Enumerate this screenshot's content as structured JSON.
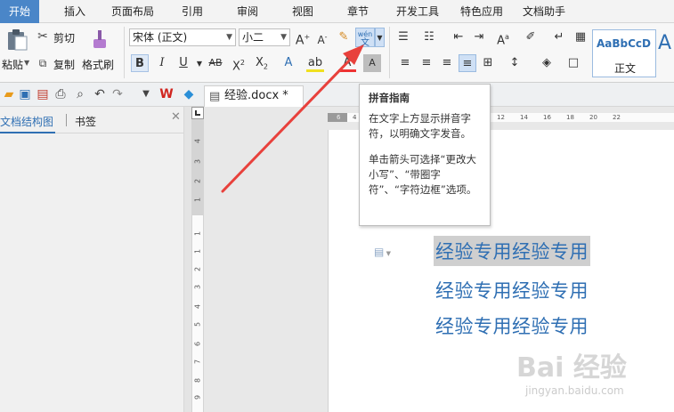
{
  "tabs": [
    "开始",
    "插入",
    "页面布局",
    "引用",
    "审阅",
    "视图",
    "章节",
    "开发工具",
    "特色应用",
    "文档助手"
  ],
  "ribbon": {
    "paste_label": "粘贴",
    "cut_label": "剪切",
    "copy_label": "复制",
    "format_painter_label": "格式刷",
    "font_name": "宋体 (正文)",
    "font_size": "小二",
    "pinyin_top": "wén",
    "pinyin_bottom": "文",
    "style_sample": "AaBbCcD",
    "style_name": "正文",
    "style_sample_2": "A"
  },
  "qat": {
    "doc_name": "经验.docx *"
  },
  "leftpanel": {
    "tab_outline": "文档结构图",
    "tab_bookmarks": "书签"
  },
  "vruler_numbers": [
    "4",
    "3",
    "2",
    "1",
    "1",
    "1",
    "2",
    "3",
    "4",
    "5",
    "6",
    "7",
    "8",
    "9",
    "10"
  ],
  "hruler_numbers": [
    "6",
    "4",
    "2",
    "2",
    "4",
    "6",
    "8",
    "10",
    "12",
    "14",
    "16",
    "18",
    "20",
    "22"
  ],
  "document": {
    "lines": [
      "经验专用经验专用",
      "经验专用经验专用",
      "经验专用经验专用"
    ]
  },
  "tooltip": {
    "title": "拼音指南",
    "line1": "在文字上方显示拼音字符，以明确文字发音。",
    "line2": "单击箭头可选择“更改大小写”、“带圈字符”、“字符边框”选项。"
  },
  "watermark": {
    "brand": "Bai 经验",
    "url": "jingyan.baidu.com"
  },
  "colors": {
    "active_tab": "#4a86c8",
    "doc_text": "#2f6fb3",
    "arrow": "#e8413c"
  }
}
